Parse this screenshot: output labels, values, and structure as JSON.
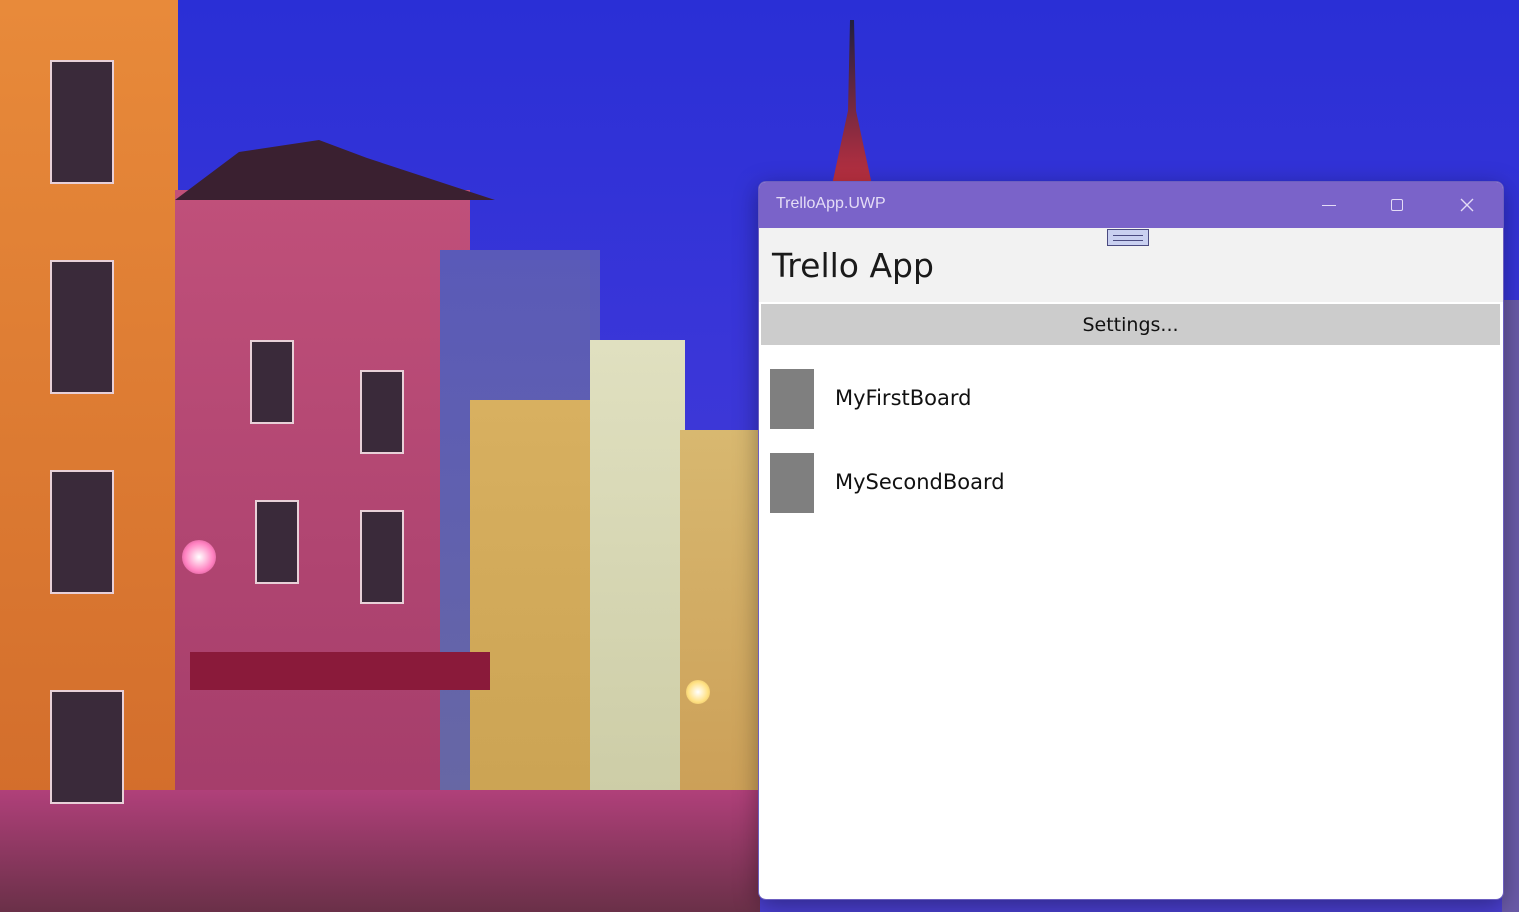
{
  "window": {
    "title": "TrelloApp.UWP",
    "close_glyph": "✕"
  },
  "app": {
    "title": "Trello App",
    "settings_label": "Settings..."
  },
  "boards": [
    {
      "name": "MyFirstBoard"
    },
    {
      "name": "MySecondBoard"
    }
  ],
  "colors": {
    "title_bar": "#7a63c9",
    "header_bg": "#f2f2f2",
    "settings_bg": "#cccccc",
    "board_thumb": "#7f7f7f"
  },
  "icons": {
    "minimize": "minimize-icon",
    "maximize": "maximize-icon",
    "close": "close-icon",
    "drag": "drag-handle-icon"
  }
}
